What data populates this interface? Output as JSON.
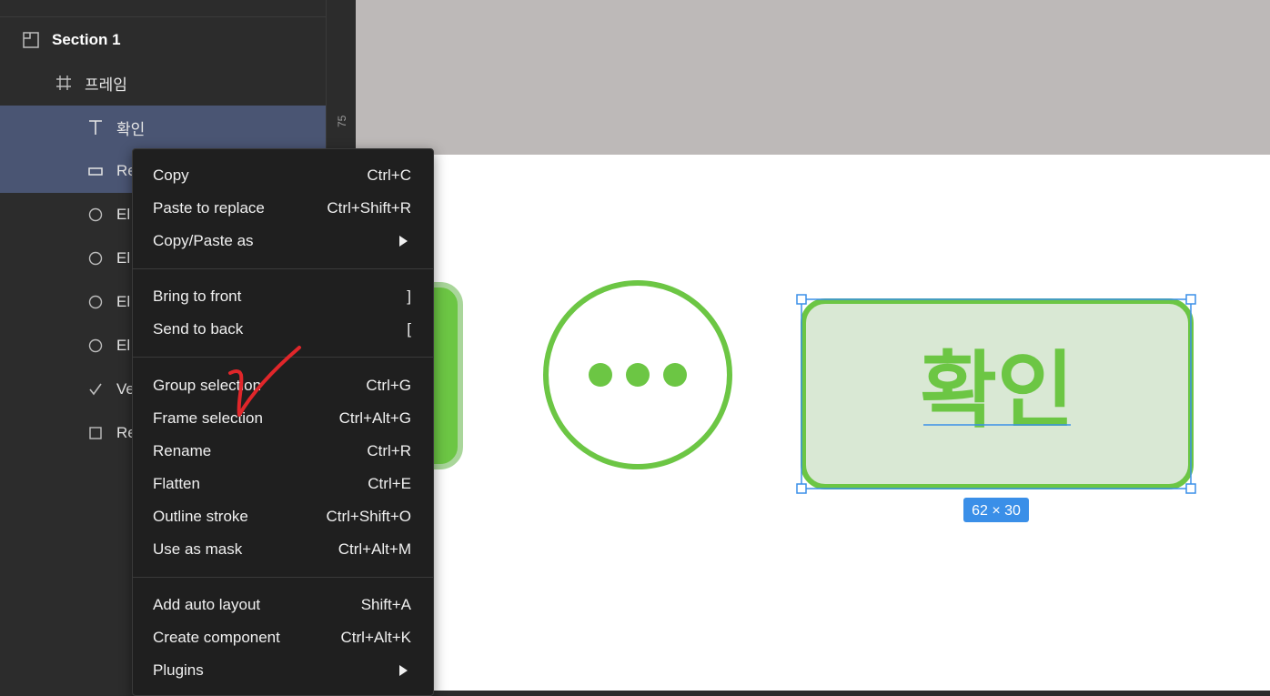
{
  "layers": {
    "items": [
      {
        "label": "Section 1",
        "icon": "section-icon"
      },
      {
        "label": "프레임",
        "icon": "frame-icon"
      },
      {
        "label": "확인",
        "icon": "text-icon"
      },
      {
        "label": "Re",
        "icon": "rectangle-icon"
      },
      {
        "label": "El",
        "icon": "ellipse-icon"
      },
      {
        "label": "El",
        "icon": "ellipse-icon"
      },
      {
        "label": "El",
        "icon": "ellipse-icon"
      },
      {
        "label": "El",
        "icon": "ellipse-icon"
      },
      {
        "label": "Ve",
        "icon": "vector-icon"
      },
      {
        "label": "Re",
        "icon": "rectangle-icon"
      }
    ]
  },
  "ruler": {
    "tick_label": "75"
  },
  "menu": {
    "copy": {
      "label": "Copy",
      "shortcut": "Ctrl+C"
    },
    "paste_replace": {
      "label": "Paste to replace",
      "shortcut": "Ctrl+Shift+R"
    },
    "copy_paste_as": {
      "label": "Copy/Paste as"
    },
    "bring_front": {
      "label": "Bring to front",
      "shortcut": "]"
    },
    "send_back": {
      "label": "Send to back",
      "shortcut": "["
    },
    "group": {
      "label": "Group selection",
      "shortcut": "Ctrl+G"
    },
    "frame": {
      "label": "Frame selection",
      "shortcut": "Ctrl+Alt+G"
    },
    "rename": {
      "label": "Rename",
      "shortcut": "Ctrl+R"
    },
    "flatten": {
      "label": "Flatten",
      "shortcut": "Ctrl+E"
    },
    "outline": {
      "label": "Outline stroke",
      "shortcut": "Ctrl+Shift+O"
    },
    "mask": {
      "label": "Use as mask",
      "shortcut": "Ctrl+Alt+M"
    },
    "auto_layout": {
      "label": "Add auto layout",
      "shortcut": "Shift+A"
    },
    "component": {
      "label": "Create component",
      "shortcut": "Ctrl+Alt+K"
    },
    "plugins": {
      "label": "Plugins"
    }
  },
  "canvas": {
    "button_text": "확인",
    "size_badge": "62 × 30",
    "colors": {
      "green": "#6cc644",
      "button_fill": "#d9e8d4",
      "selection": "#3a8fe8",
      "gray_area": "#bdb9b8"
    }
  }
}
